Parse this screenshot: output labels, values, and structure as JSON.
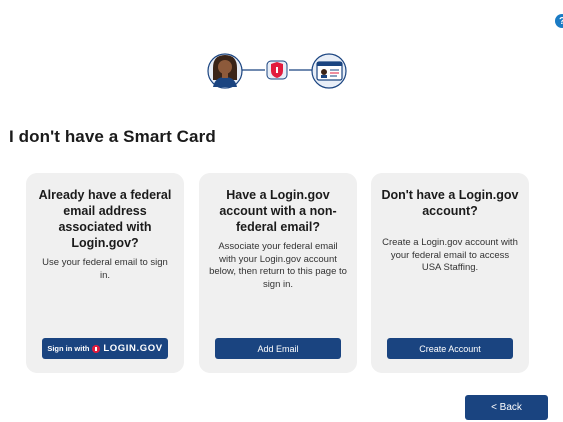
{
  "help": {
    "icon": "?"
  },
  "hero": {
    "icons": [
      "user-avatar-icon",
      "shield-icon",
      "id-card-icon"
    ]
  },
  "page_title": "I don't have a Smart Card",
  "cards": [
    {
      "heading": "Already have a federal email address associated with Login.gov?",
      "text": "Use your federal email to sign in.",
      "button": {
        "prefix": "Sign in with",
        "brand": "LOGIN.GOV"
      }
    },
    {
      "heading": "Have a Login.gov account with a non-federal email?",
      "text": "Associate your federal email with your Login.gov account below, then return to this page to sign in.",
      "button": {
        "label": "Add Email"
      }
    },
    {
      "heading": "Don't have a Login.gov account?",
      "text": "Create a Login.gov account with your federal email to access USA Staffing.",
      "button": {
        "label": "Create Account"
      }
    }
  ],
  "back_button": "< Back",
  "colors": {
    "primary": "#1a4480",
    "card_bg": "#f0f0f0",
    "brand_red": "#e21c3d",
    "help": "#1a7bc4"
  }
}
